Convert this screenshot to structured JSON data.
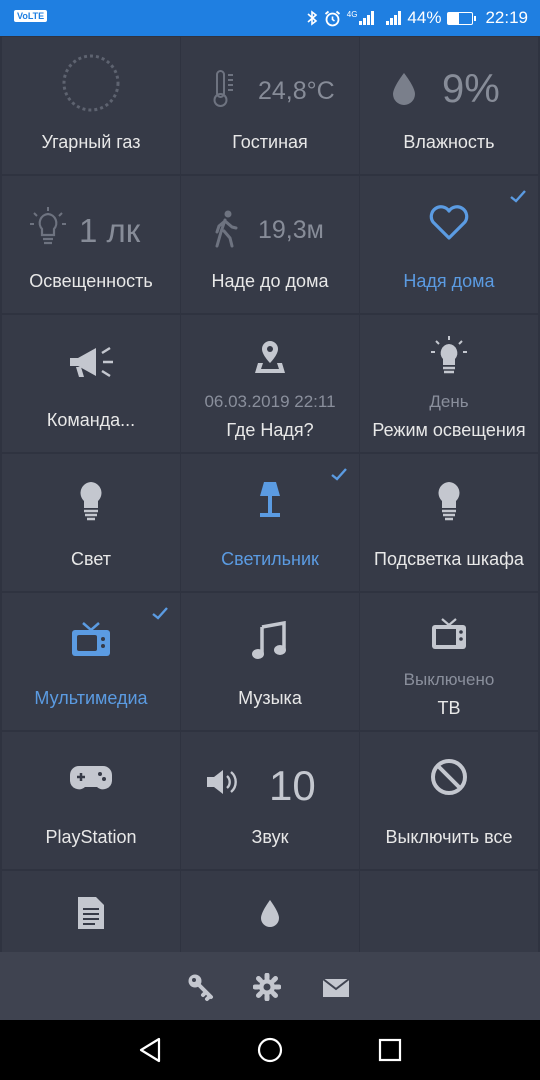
{
  "statusbar": {
    "volte": "VoLTE",
    "battery_pct": "44%",
    "time": "22:19",
    "network": "4G",
    "battery_level": 0.44
  },
  "tiles": {
    "co": {
      "label": "Угарный газ"
    },
    "temp": {
      "value": "24,8°C",
      "label": "Гостиная"
    },
    "humidity": {
      "value": "9%",
      "label": "Влажность"
    },
    "illum": {
      "value": "1 лк",
      "label": "Освещенность"
    },
    "distance": {
      "value": "19,3м",
      "label": "Наде до дома"
    },
    "nadya_home": {
      "label": "Надя дома"
    },
    "command": {
      "label": "Команда..."
    },
    "where": {
      "sub": "06.03.2019 22:11",
      "label": "Где Надя?"
    },
    "light_mode": {
      "sub": "День",
      "label": "Режим освещения"
    },
    "light": {
      "label": "Свет"
    },
    "lamp": {
      "label": "Светильник"
    },
    "wardrobe": {
      "label": "Подсветка шкафа"
    },
    "multimedia": {
      "label": "Мультимедиа"
    },
    "music": {
      "label": "Музыка"
    },
    "tv": {
      "sub": "Выключено",
      "label": "ТВ"
    },
    "playstation": {
      "label": "PlayStation"
    },
    "sound": {
      "value": "10",
      "label": "Звук"
    },
    "all_off": {
      "label": "Выключить все"
    }
  },
  "colors": {
    "accent": "#5b9be2",
    "tile": "#363a47",
    "background": "#2f3340",
    "statusbar": "#1f7fe1",
    "icon": "#c4c7cf"
  }
}
